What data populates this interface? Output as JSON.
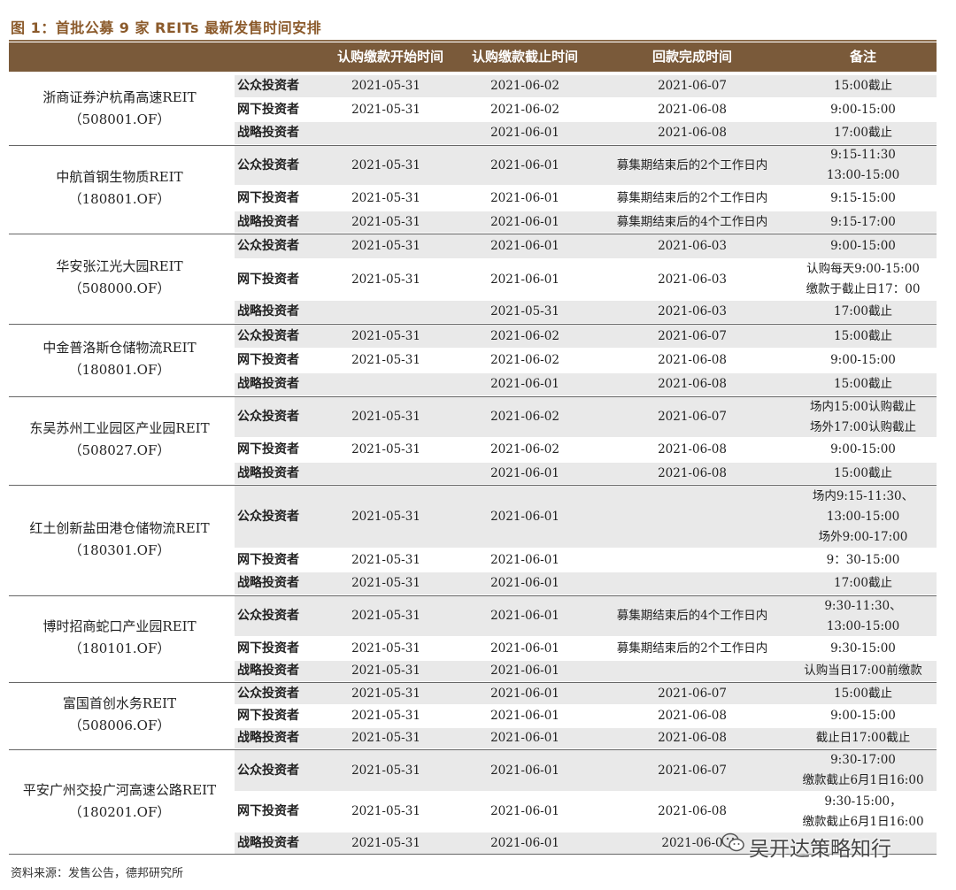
{
  "figure_title": "图 1：首批公募 9 家 REITs 最新发售时间安排",
  "header": [
    "认购缴款开始时间",
    "认购缴款截止时间",
    "回款完成时间",
    "备注"
  ],
  "funds": [
    {
      "name": "浙商证券沪杭甬高速REIT",
      "code": "（508001.OF）",
      "rows": [
        {
          "type": "公众投资者",
          "start": "2021-05-31",
          "end": "2021-06-02",
          "refund": "2021-06-07",
          "note": [
            "15:00截止"
          ]
        },
        {
          "type": "网下投资者",
          "start": "2021-05-31",
          "end": "2021-06-02",
          "refund": "2021-06-08",
          "note": [
            "9:00-15:00"
          ]
        },
        {
          "type": "战略投资者",
          "start": "",
          "end": "2021-06-01",
          "refund": "2021-06-08",
          "note": [
            "17:00截止"
          ]
        }
      ]
    },
    {
      "name": "中航首钢生物质REIT",
      "code": "（180801.OF）",
      "rows": [
        {
          "type": "公众投资者",
          "start": "2021-05-31",
          "end": "2021-06-01",
          "refund": "募集期结束后的2个工作日内",
          "note": [
            "9:15-11:30",
            "13:00-15:00"
          ]
        },
        {
          "type": "网下投资者",
          "start": "2021-05-31",
          "end": "2021-06-01",
          "refund": "募集期结束后的2个工作日内",
          "note": [
            "9:15-15:00"
          ]
        },
        {
          "type": "战略投资者",
          "start": "2021-05-31",
          "end": "2021-06-01",
          "refund": "募集期结束后的4个工作日内",
          "note": [
            "9:15-17:00"
          ]
        }
      ]
    },
    {
      "name": "华安张江光大园REIT",
      "code": "（508000.OF）",
      "rows": [
        {
          "type": "公众投资者",
          "start": "2021-05-31",
          "end": "2021-06-01",
          "refund": "2021-06-03",
          "note": [
            "9:00-15:00"
          ]
        },
        {
          "type": "网下投资者",
          "start": "2021-05-31",
          "end": "2021-06-01",
          "refund": "2021-06-03",
          "note": [
            "认购每天9:00-15:00",
            "缴款于截止日17：00"
          ]
        },
        {
          "type": "战略投资者",
          "start": "",
          "end": "2021-05-31",
          "refund": "2021-06-03",
          "note": [
            "17:00截止"
          ]
        }
      ]
    },
    {
      "name": "中金普洛斯仓储物流REIT",
      "code": "（180801.OF）",
      "rows": [
        {
          "type": "公众投资者",
          "start": "2021-05-31",
          "end": "2021-06-02",
          "refund": "2021-06-07",
          "note": [
            "15:00截止"
          ]
        },
        {
          "type": "网下投资者",
          "start": "2021-05-31",
          "end": "2021-06-02",
          "refund": "2021-06-08",
          "note": [
            "9:00-15:00"
          ]
        },
        {
          "type": "战略投资者",
          "start": "",
          "end": "2021-06-01",
          "refund": "2021-06-08",
          "note": [
            "15:00截止"
          ]
        }
      ]
    },
    {
      "name": "东吴苏州工业园区产业园REIT",
      "code": "（508027.OF）",
      "rows": [
        {
          "type": "公众投资者",
          "start": "2021-05-31",
          "end": "2021-06-02",
          "refund": "2021-06-07",
          "note": [
            "场内15:00认购截止",
            "场外17:00认购截止"
          ]
        },
        {
          "type": "网下投资者",
          "start": "2021-05-31",
          "end": "2021-06-02",
          "refund": "2021-06-08",
          "note": [
            "9:00-15:00"
          ]
        },
        {
          "type": "战略投资者",
          "start": "",
          "end": "2021-06-01",
          "refund": "2021-06-08",
          "note": [
            "15:00截止"
          ]
        }
      ]
    },
    {
      "name": "红土创新盐田港仓储物流REIT",
      "code": "（180301.OF）",
      "rows": [
        {
          "type": "公众投资者",
          "start": "2021-05-31",
          "end": "2021-06-01",
          "refund": "",
          "note": [
            "场内9:15-11:30、",
            "13:00-15:00",
            "场外9:00-17:00"
          ]
        },
        {
          "type": "网下投资者",
          "start": "2021-05-31",
          "end": "2021-06-01",
          "refund": "",
          "note": [
            "9：30-15:00"
          ]
        },
        {
          "type": "战略投资者",
          "start": "2021-05-31",
          "end": "2021-06-01",
          "refund": "",
          "note": [
            "17:00截止"
          ]
        }
      ]
    },
    {
      "name": "博时招商蛇口产业园REIT",
      "code": "（180101.OF）",
      "rows": [
        {
          "type": "公众投资者",
          "start": "2021-05-31",
          "end": "2021-06-01",
          "refund": "募集期结束后的4个工作日内",
          "note": [
            "9:30-11:30、",
            "13:00-15:00"
          ]
        },
        {
          "type": "网下投资者",
          "start": "2021-05-31",
          "end": "2021-06-01",
          "refund": "募集期结束后的2个工作日内",
          "note": [
            "9:30-15:00"
          ]
        },
        {
          "type": "战略投资者",
          "start": "2021-05-31",
          "end": "2021-06-01",
          "refund": "",
          "note": [
            "认购当日17:00前缴款"
          ]
        }
      ]
    },
    {
      "name": "富国首创水务REIT",
      "code": "（508006.OF）",
      "rows": [
        {
          "type": "公众投资者",
          "start": "2021-05-31",
          "end": "2021-06-01",
          "refund": "2021-06-07",
          "note": [
            "15:00截止"
          ]
        },
        {
          "type": "网下投资者",
          "start": "2021-05-31",
          "end": "2021-06-01",
          "refund": "2021-06-08",
          "note": [
            "9:00-15:00"
          ]
        },
        {
          "type": "战略投资者",
          "start": "2021-05-31",
          "end": "2021-06-01",
          "refund": "2021-06-08",
          "note": [
            "截止日17:00截止"
          ]
        }
      ]
    },
    {
      "name": "平安广州交投广河高速公路REIT",
      "code": "（180201.OF）",
      "rows": [
        {
          "type": "公众投资者",
          "start": "2021-05-31",
          "end": "2021-06-01",
          "refund": "2021-06-07",
          "note": [
            "9:30-17:00",
            "缴款截止6月1日16:00"
          ]
        },
        {
          "type": "网下投资者",
          "start": "2021-05-31",
          "end": "2021-06-01",
          "refund": "2021-06-08",
          "note": [
            "9:30-15:00，",
            "缴款截止6月1日16:00"
          ]
        },
        {
          "type": "战略投资者",
          "start": "2021-05-31",
          "end": "2021-06-01",
          "refund": "2021-06-0",
          "note": [
            ""
          ]
        }
      ]
    }
  ],
  "source": "资料来源：发售公告，德邦研究所",
  "watermark": "吴开达策略知行"
}
